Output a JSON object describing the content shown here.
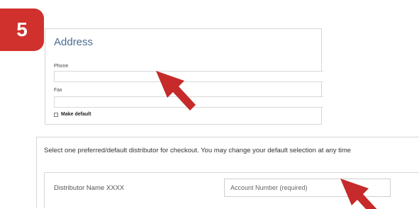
{
  "step": {
    "number": "5",
    "color": "#d0312d"
  },
  "address_panel": {
    "title": "Address",
    "phone_label": "Phone",
    "phone_value": "",
    "fax_label": "Fax",
    "fax_value": "",
    "make_default_label": "Make default",
    "make_default_checked": false
  },
  "distributor_panel": {
    "instruction": "Select one preferred/default distributor for checkout. You may change your default selection at any time",
    "rows": [
      {
        "name": "Distributor Name XXXX",
        "account_placeholder": "Account Number (required)",
        "account_value": ""
      }
    ]
  },
  "annotations": {
    "arrow_color": "#c62a2a",
    "arrow_count": 2
  }
}
